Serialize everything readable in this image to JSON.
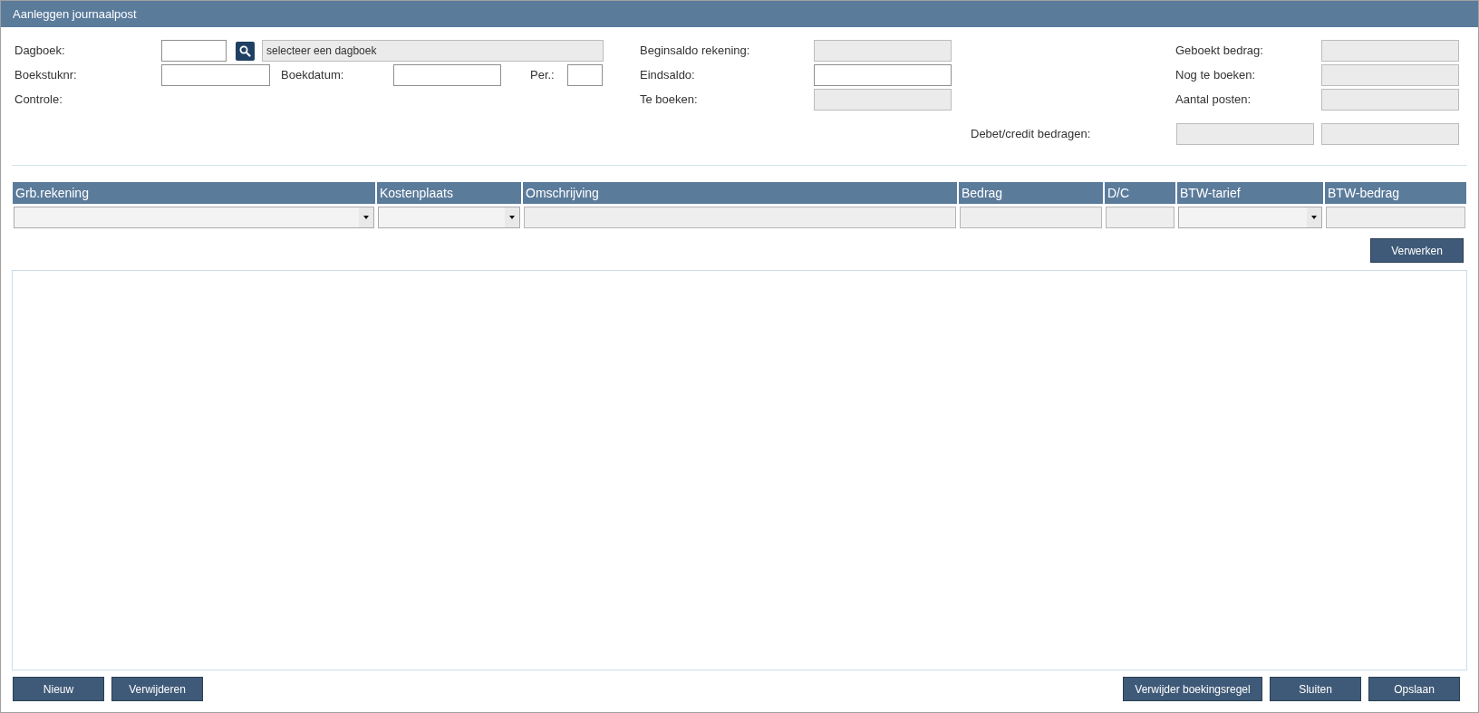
{
  "window": {
    "title": "Aanleggen journaalpost"
  },
  "journal": {
    "label": "Dagboek:",
    "code": {
      "disabled": false
    },
    "description": {
      "value": "selecteer een dagboek",
      "disabled": true
    }
  },
  "document_number": {
    "label": "Boekstuknr:",
    "disabled": false
  },
  "booking_date": {
    "label": "Boekdatum:",
    "disabled": false
  },
  "period": {
    "label": "Per.:",
    "disabled": false
  },
  "check": {
    "label": "Controle:"
  },
  "balances": [
    {
      "label": "Beginsaldo rekening:",
      "disabled": true
    },
    {
      "label": "Eindsaldo:",
      "disabled": false
    },
    {
      "label": "Te boeken:",
      "disabled": true
    }
  ],
  "totals": [
    {
      "label": "Geboekt bedrag:",
      "disabled": true
    },
    {
      "label": "Nog te boeken:",
      "disabled": true
    },
    {
      "label": "Aantal posten:",
      "disabled": true
    }
  ],
  "debit_credit": {
    "label": "Debet/credit bedragen:",
    "fields": [
      {
        "disabled": true
      },
      {
        "disabled": true
      }
    ]
  },
  "entry_grid": {
    "columns": [
      {
        "label": "Grb.rekening",
        "kind": "select"
      },
      {
        "label": "Kostenplaats",
        "kind": "select"
      },
      {
        "label": "Omschrijving",
        "kind": "text"
      },
      {
        "label": "Bedrag",
        "kind": "text"
      },
      {
        "label": "D/C",
        "kind": "text"
      },
      {
        "label": "BTW-tarief",
        "kind": "select"
      },
      {
        "label": "BTW-bedrag",
        "kind": "text"
      }
    ]
  },
  "process_button": "Verwerken",
  "bottom_left_buttons": [
    "Nieuw",
    "Verwijderen"
  ],
  "bottom_right_buttons": [
    "Verwijder boekingsregel",
    "Sluiten",
    "Opslaan"
  ]
}
